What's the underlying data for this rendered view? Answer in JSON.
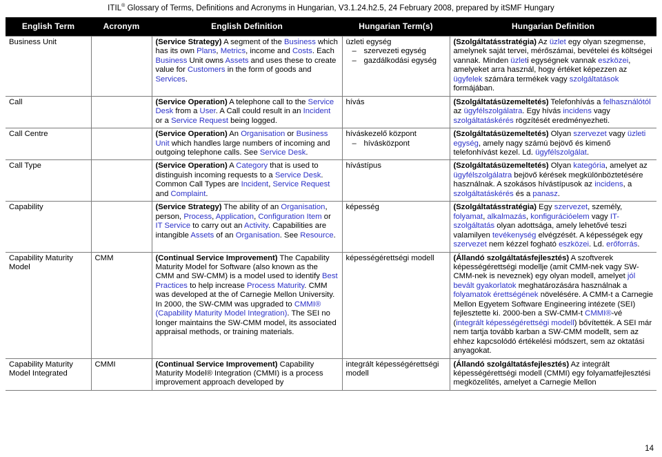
{
  "document": {
    "header_prefix": "ITIL",
    "header_sup": "®",
    "header_rest": " Glossary of Terms, Definitions and Acronyms in Hungarian, V3.1.24.h2.5, 24 February 2008, prepared by itSMF Hungary",
    "page_number": "14",
    "link_color": "#2b31c8",
    "header_bg": "#000000",
    "header_fg": "#ffffff",
    "border_color": "#7a7a7a"
  },
  "table": {
    "columns": [
      {
        "key": "english_term",
        "label": "English Term"
      },
      {
        "key": "acronym",
        "label": "Acronym"
      },
      {
        "key": "english_definition",
        "label": "English Definition"
      },
      {
        "key": "hungarian_terms",
        "label": "Hungarian Term(s)"
      },
      {
        "key": "hungarian_definition",
        "label": "Hungarian Definition"
      }
    ],
    "rows": [
      {
        "english_term": "Business Unit",
        "acronym": "",
        "english_definition_label": "(Service Strategy)",
        "english_definition": " A segment of the Business which has its own Plans, Metrics, income and Costs. Each Business Unit owns Assets and uses these to create value for Customers in the form of goods and Services.",
        "english_links": [
          "Business",
          "Plans",
          "Metrics",
          "Costs",
          "Assets",
          "Customers",
          "Services"
        ],
        "hungarian_term_main": "üzleti egység",
        "hungarian_term_alts": [
          "szervezeti egység",
          "gazdálkodási egység"
        ],
        "hungarian_definition_label": "(Szolgáltatásstratégia)",
        "hungarian_definition": " Az üzlet egy olyan szegmense, amelynek saját tervei, mérőszámai, bevételei és költségei vannak. Minden üzleti egységnek vannak eszközei, amelyeket arra használ, hogy értéket képezzen az ügyfelek számára termékek vagy szolgáltatások formájában.",
        "hungarian_links": [
          "üzlet",
          "eszközei",
          "ügyfelek",
          "szolgáltatások"
        ]
      },
      {
        "english_term": "Call",
        "acronym": "",
        "english_definition_label": "(Service Operation)",
        "english_definition": " A telephone call to the Service Desk from a User. A Call could result in an Incident or a Service Request being logged.",
        "english_links": [
          "Service Desk",
          "User",
          "Incident",
          "Service Request"
        ],
        "hungarian_term_main": "hívás",
        "hungarian_term_alts": [],
        "hungarian_definition_label": "(Szolgáltatásüzemeltetés)",
        "hungarian_definition": " Telefonhívás a felhasználótól az ügyfélszolgálatra. Egy hívás incidens vagy szolgáltatáskérés rögzítését eredményezheti.",
        "hungarian_links": [
          "felhasználótól",
          "ügyfélszolgálatra",
          "incidens",
          "szolgáltatáskérés"
        ]
      },
      {
        "english_term": "Call Centre",
        "acronym": "",
        "english_definition_label": "(Service Operation)",
        "english_definition": " An Organisation or Business Unit which handles large numbers of incoming and outgoing telephone calls. See Service Desk.",
        "english_links": [
          "Organisation",
          "Business Unit",
          "Service Desk"
        ],
        "hungarian_term_main": "híváskezelő központ",
        "hungarian_term_alts": [
          "hívásközpont"
        ],
        "hungarian_definition_label": "(Szolgáltatásüzemeltetés)",
        "hungarian_definition": " Olyan szervezet vagy üzleti egység, amely nagy számú bejövő és kimenő telefonhívást kezel. Ld. ügyfélszolgálat.",
        "hungarian_links": [
          "szervezet",
          "üzleti egység",
          "ügyfélszolgálat"
        ]
      },
      {
        "english_term": "Call Type",
        "acronym": "",
        "english_definition_label": "(Service Operation)",
        "english_definition": " A Category that is used to distinguish incoming requests to a Service Desk. Common Call Types are Incident, Service Request and Complaint.",
        "english_links": [
          "Category",
          "Service Desk",
          "Incident",
          "Service Request",
          "Complaint"
        ],
        "hungarian_term_main": "hívástípus",
        "hungarian_term_alts": [],
        "hungarian_definition_label": "(Szolgáltatásüzemeltetés)",
        "hungarian_definition": " Olyan kategória, amelyet az ügyfélszolgálatra bejövő kérések megkülönböztetésére használnak. A szokásos hívástípusok az incidens, a szolgáltatáskérés és a panasz.",
        "hungarian_links": [
          "kategória",
          "ügyfélszolgálatra",
          "incidens",
          "szolgáltatáskérés",
          "panasz"
        ]
      },
      {
        "english_term": "Capability",
        "acronym": "",
        "english_definition_label": "(Service Strategy)",
        "english_definition": " The ability of an Organisation, person, Process, Application, Configuration Item or IT Service to carry out an Activity. Capabilities are intangible Assets of an Organisation. See Resource.",
        "english_links": [
          "Organisation",
          "Process",
          "Application",
          "Configuration Item",
          "IT Service",
          "Activity",
          "Assets",
          "Resource"
        ],
        "hungarian_term_main": "képesség",
        "hungarian_term_alts": [],
        "hungarian_definition_label": "(Szolgáltatásstratégia)",
        "hungarian_definition": " Egy szervezet, személy, folyamat, alkalmazás, konfigurációelem vagy IT-szolgáltatás olyan adottsága, amely lehetővé teszi valamilyen tevékenység elvégzését. A képességek egy szervezet nem kézzel fogható eszközei. Ld. erőforrás.",
        "hungarian_links": [
          "szervezet",
          "folyamat",
          "alkalmazás",
          "konfigurációelem",
          "IT-szolgáltatás",
          "tevékenység",
          "eszközei",
          "erőforrás"
        ]
      },
      {
        "english_term": "Capability Maturity Model",
        "acronym": "CMM",
        "english_definition_label": "(Continual Service Improvement)",
        "english_definition": " The Capability Maturity Model for Software (also known as the CMM and SW-CMM) is a model used to identify Best Practices to help increase Process Maturity. CMM was developed at the of Carnegie Mellon University. In 2000, the SW-CMM was upgraded to CMMI® (Capability Maturity Model Integration). The SEI no longer maintains the SW-CMM model, its associated appraisal methods, or training materials.",
        "english_links": [
          "Best Practices",
          "Process Maturity",
          "CMMI® (Capability Maturity Model Integration)"
        ],
        "hungarian_term_main": "képességérettségi modell",
        "hungarian_term_alts": [],
        "hungarian_definition_label": "(Állandó szolgáltatásfejlesztés)",
        "hungarian_definition": " A szoftverek képességérettségi modellje (amit CMM-nek vagy SW-CMM-nek is neveznek) egy olyan modell, amelyet jól bevált gyakorlatok meghatározására használnak a folyamatok érettségének növelésére. A CMM-t a Carnegie Mellon Egyetem Software Engineering intézete (SEI) fejlesztette ki. 2000-ben a SW-CMM-t CMMI®-vé (integrált képességérettségi modell) bővítették. A SEI már nem tartja tovább karban a SW-CMM modellt, sem az ehhez kapcsolódó értékelési módszert, sem az oktatási anyagokat.",
        "hungarian_links": [
          "jól bevált gyakorlatok",
          "folyamatok érettségének",
          "CMMI®",
          "integrált képességérettségi modell"
        ]
      },
      {
        "english_term": "Capability Maturity Model Integrated",
        "acronym": "CMMI",
        "english_definition_label": "(Continual Service Improvement)",
        "english_definition": " Capability Maturity Model® Integration (CMMI) is a process improvement approach developed by",
        "english_links": [],
        "hungarian_term_main": "integrált képességérettségi modell",
        "hungarian_term_alts": [],
        "hungarian_definition_label": "(Állandó szolgáltatásfejlesztés)",
        "hungarian_definition": " Az integrált képességérettségi modell (CMMI) egy folyamatfejlesztési megközelítés, amelyet a Carnegie Mellon",
        "hungarian_links": []
      }
    ]
  }
}
